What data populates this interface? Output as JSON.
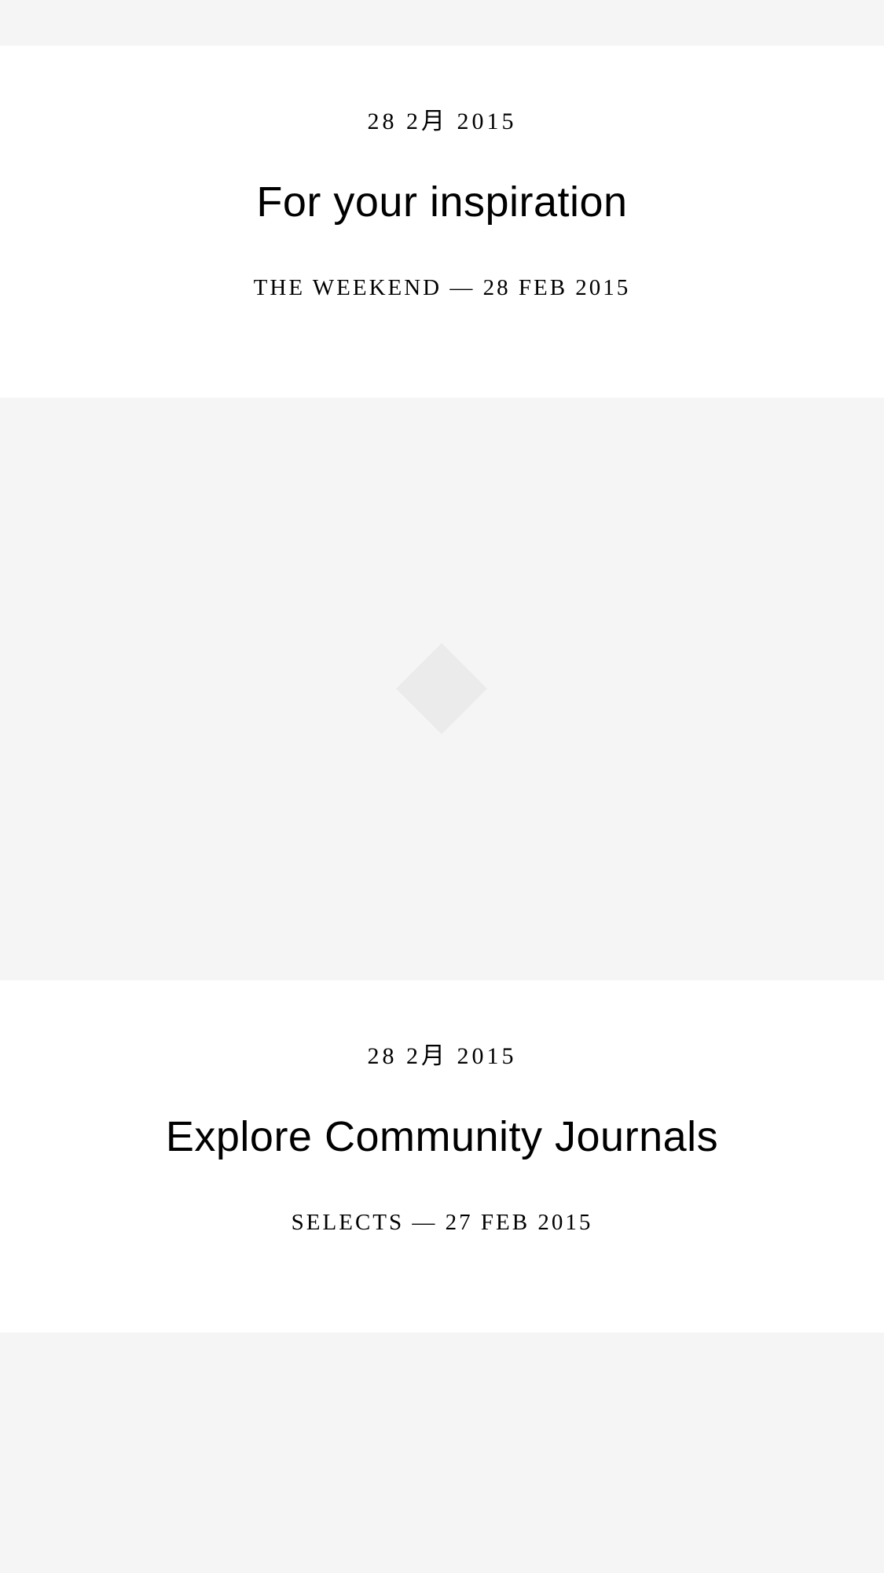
{
  "feed": {
    "articles": [
      {
        "date": "28 2月 2015",
        "title": "For your inspiration",
        "meta": "THE WEEKEND — 28 FEB 2015"
      },
      {
        "date": "28 2月 2015",
        "title": "Explore Community Journals",
        "meta": "SELECTS — 27 FEB 2015"
      }
    ],
    "image_placeholder_icon": "diamond-placeholder-icon",
    "colors": {
      "background": "#f5f5f5",
      "card": "#ffffff",
      "placeholder": "#ebebeb",
      "text": "#000000"
    }
  }
}
